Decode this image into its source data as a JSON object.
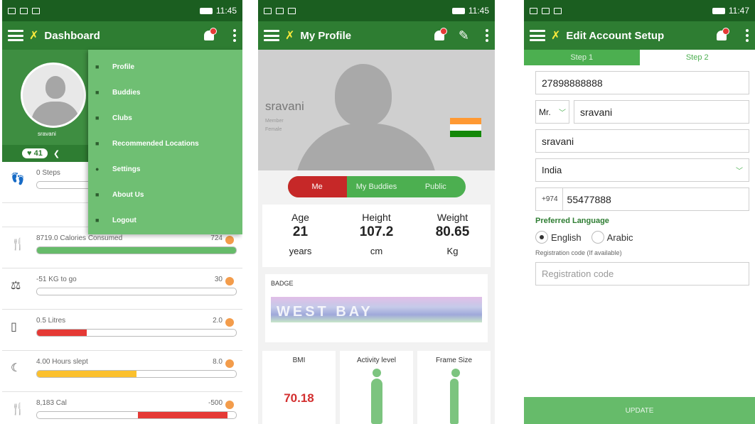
{
  "screen1": {
    "status": {
      "time": "11:45"
    },
    "title": "Dashboard",
    "username": "sravani",
    "likes": "41",
    "menu": [
      {
        "label": "Profile",
        "icon": "person-icon"
      },
      {
        "label": "Buddies",
        "icon": "group-icon"
      },
      {
        "label": "Clubs",
        "icon": "club-icon"
      },
      {
        "label": "Recommended Locations",
        "icon": "location-icon"
      },
      {
        "label": "Settings",
        "icon": "gear-icon"
      },
      {
        "label": "About Us",
        "icon": "info-icon"
      },
      {
        "label": "Logout",
        "icon": "logout-icon"
      }
    ],
    "rows": [
      {
        "icon": "footsteps-icon",
        "label": "0 Steps",
        "value": "",
        "progress": 0,
        "color": "#4caf50"
      },
      {
        "icon": "cutlery-icon",
        "label": "8719.0 Calories Consumed",
        "value": "724",
        "progress": 1.0,
        "color": "#66bb6a"
      },
      {
        "icon": "scale-icon",
        "label": "-51 KG to go",
        "value": "30",
        "progress": 0,
        "color": "#4caf50"
      },
      {
        "icon": "water-glass-icon",
        "label": "0.5 Litres",
        "value": "2.0",
        "progress": 0.25,
        "color": "#e53935"
      },
      {
        "icon": "moon-icon",
        "label": "4.00 Hours slept",
        "value": "8.0",
        "progress": 0.5,
        "color": "#fbc02d"
      },
      {
        "icon": "food-exercise-icon",
        "label": "8,183 Cal",
        "value": "-500",
        "progress": 0.45,
        "color": "#e53935"
      }
    ]
  },
  "screen2": {
    "status": {
      "time": "11:45"
    },
    "title": "My Profile",
    "name": "sravani",
    "sub1": "Member",
    "sub2": "Female",
    "tabs": [
      "Me",
      "My Buddies",
      "Public"
    ],
    "stats": [
      {
        "label": "Age",
        "value": "21",
        "unit": "years"
      },
      {
        "label": "Height",
        "value": "107.2",
        "unit": "cm"
      },
      {
        "label": "Weight",
        "value": "80.65",
        "unit": "Kg"
      }
    ],
    "badge_label": "BADGE",
    "badge_text": "WEST BAY",
    "cards": [
      {
        "label": "BMI",
        "value": "70.18"
      },
      {
        "label": "Activity level",
        "value": ""
      },
      {
        "label": "Frame Size",
        "value": ""
      }
    ]
  },
  "screen3": {
    "status": {
      "time": "11:47"
    },
    "title": "Edit Account Setup",
    "step1": "Step 1",
    "step2": "Step 2",
    "id_value": "27898888888",
    "salutation": "Mr.",
    "first_name": "sravani",
    "last_name": "sravani",
    "country": "India",
    "country_code": "+974",
    "phone": "55477888",
    "pref_label": "Preferred Language",
    "lang1": "English",
    "lang2": "Arabic",
    "reg_label": "Registration code (If available)",
    "reg_placeholder": "Registration code",
    "update_label": "UPDATE"
  }
}
